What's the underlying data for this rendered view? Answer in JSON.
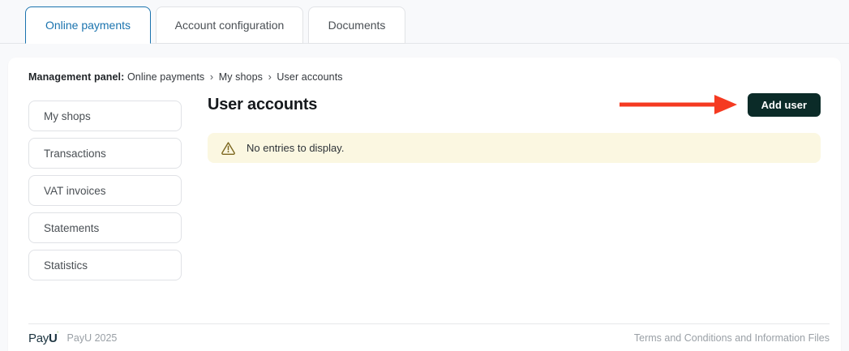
{
  "tabs": [
    {
      "label": "Online payments",
      "active": true
    },
    {
      "label": "Account configuration",
      "active": false
    },
    {
      "label": "Documents",
      "active": false
    }
  ],
  "breadcrumb": {
    "prefix": "Management panel:",
    "separator": "›",
    "items": [
      "Online payments",
      "My shops",
      "User accounts"
    ]
  },
  "sidebar": {
    "items": [
      {
        "label": "My shops"
      },
      {
        "label": "Transactions"
      },
      {
        "label": "VAT invoices"
      },
      {
        "label": "Statements"
      },
      {
        "label": "Statistics"
      }
    ]
  },
  "main": {
    "title": "User accounts",
    "add_user_label": "Add user",
    "alert": {
      "icon": "warning-triangle-icon",
      "message": "No entries to display."
    }
  },
  "footer": {
    "logo_pay": "Pay",
    "logo_u": "U",
    "copyright": "PayU 2025",
    "terms_label": "Terms and Conditions and Information Files"
  },
  "annotations": {
    "arrow_description": "red arrow pointing to Add user button"
  },
  "colors": {
    "accent_blue": "#1a73ae",
    "button_dark": "#0b2b28",
    "arrow_red": "#f53a21",
    "alert_bg": "#fbf7e1",
    "alert_icon": "#7c671f",
    "page_bg": "#f8f9fb",
    "muted_text": "#9aa0a6",
    "logo_green": "#7ab83a"
  }
}
